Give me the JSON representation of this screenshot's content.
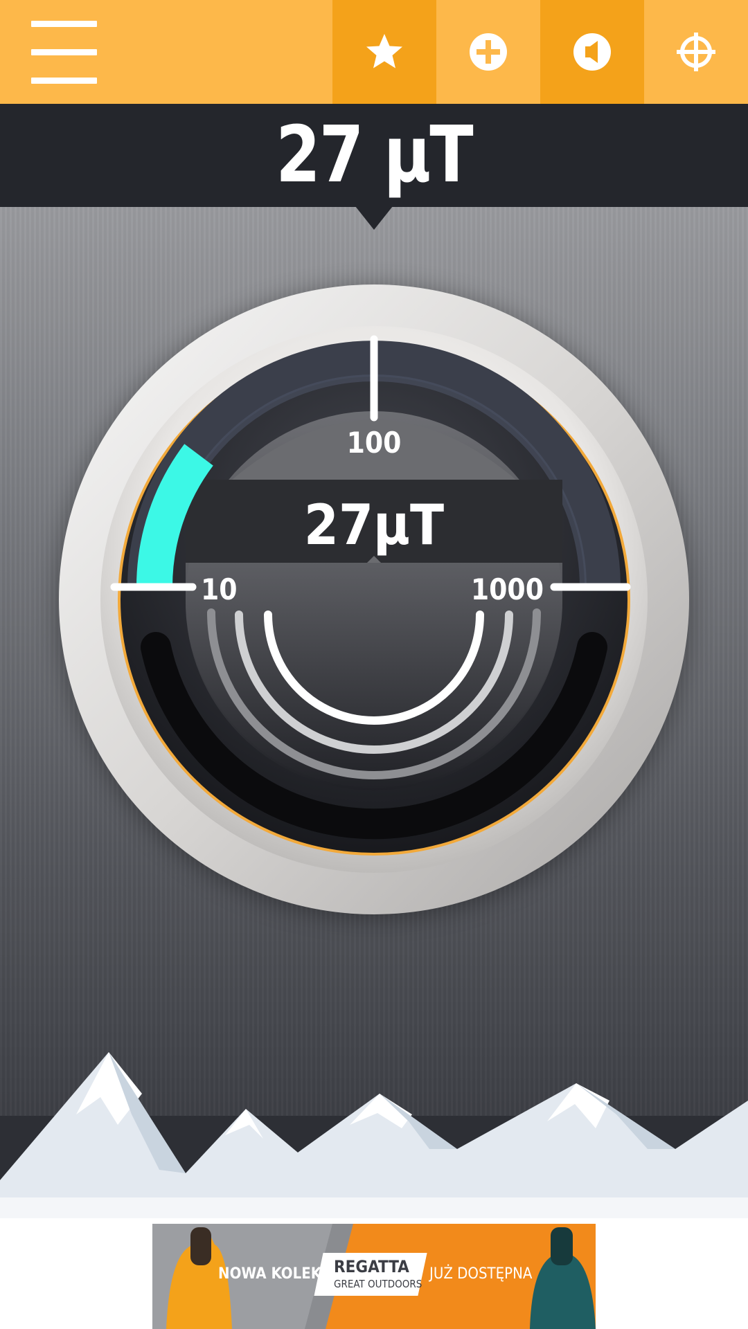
{
  "toolbar": {
    "buttons": [
      {
        "name": "favorite-button",
        "icon": "star-icon"
      },
      {
        "name": "add-button",
        "icon": "plus-circle-icon"
      },
      {
        "name": "sound-button",
        "icon": "speaker-icon"
      },
      {
        "name": "calibrate-button",
        "icon": "crosshair-icon"
      }
    ],
    "menu_icon": "hamburger-menu-icon"
  },
  "reading": {
    "header_value": "27 μT",
    "dial_value": "27μT",
    "value": 27,
    "unit": "μT"
  },
  "gauge": {
    "scale_labels": {
      "low": "10",
      "mid": "100",
      "high": "1000"
    },
    "scale": "logarithmic",
    "min": 10,
    "max": 1000
  },
  "ad": {
    "left_text": "NOWA KOLEKCJA",
    "brand": "REGATTA",
    "brand_sub": "GREAT OUTDOORS",
    "right_text": "JUŻ DOSTĘPNA"
  },
  "colors": {
    "accent": "#fdb84a",
    "accent_dark": "#f4a21a",
    "needle": "#3cf8e6",
    "panel": "#24262c"
  }
}
